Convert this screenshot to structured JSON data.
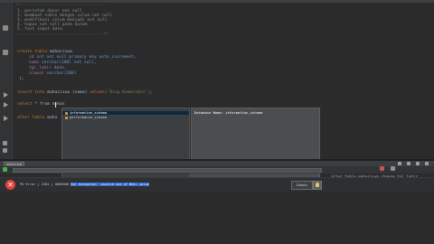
{
  "colors": {
    "editor_bg": "#2b2b2b",
    "keyword": "#cc7832",
    "string": "#6a8759",
    "comment": "#8a8f94",
    "selection": "#2f65ca",
    "error": "#e0443c"
  },
  "editor": {
    "comment_lines": [
      "1. perintah dasar not null",
      "2. membuat table dengan colum not null",
      "3. modifikasi colum menjadi not null",
      "4. hapus not null pada kolom",
      "5. test input data"
    ],
    "create": {
      "kw": "create table",
      "name": "mahasiswa",
      "cols": [
        {
          "name": "id",
          "type": "int not null primary key auto_increment,"
        },
        {
          "name": "nama",
          "type": "varchar(100) not null,"
        },
        {
          "name": "tgl_lahir",
          "type": "date,"
        },
        {
          "name": "alamat",
          "type": "varchar(200)"
        }
      ],
      "close": ");"
    },
    "insert": {
      "kw": "insert into",
      "table": "mahasiswa (nama)",
      "values_kw": "values",
      "value": "('Diop Komarudin')",
      "end": ";"
    },
    "select": {
      "kw": "select",
      "rest": "* from",
      "typed": "mahas"
    },
    "alter": {
      "kw": "alter table",
      "rest": "maha"
    }
  },
  "autocomplete": {
    "items": [
      {
        "label": "information_schema",
        "selected": true
      },
      {
        "label": "performance_schema",
        "selected": false
      }
    ],
    "doc_text": "Database Name: information_schema"
  },
  "panel": {
    "tab_label": "mahasiswa",
    "result_line": "alter table mahasiswa change tgl_lahir"
  },
  "status": {
    "error_prefix": "PU Error | 1364 | 0000000",
    "error_highlight": "Sql exception: invalid use of NULL value",
    "details_button": "Details",
    "icon": "error-icon"
  }
}
